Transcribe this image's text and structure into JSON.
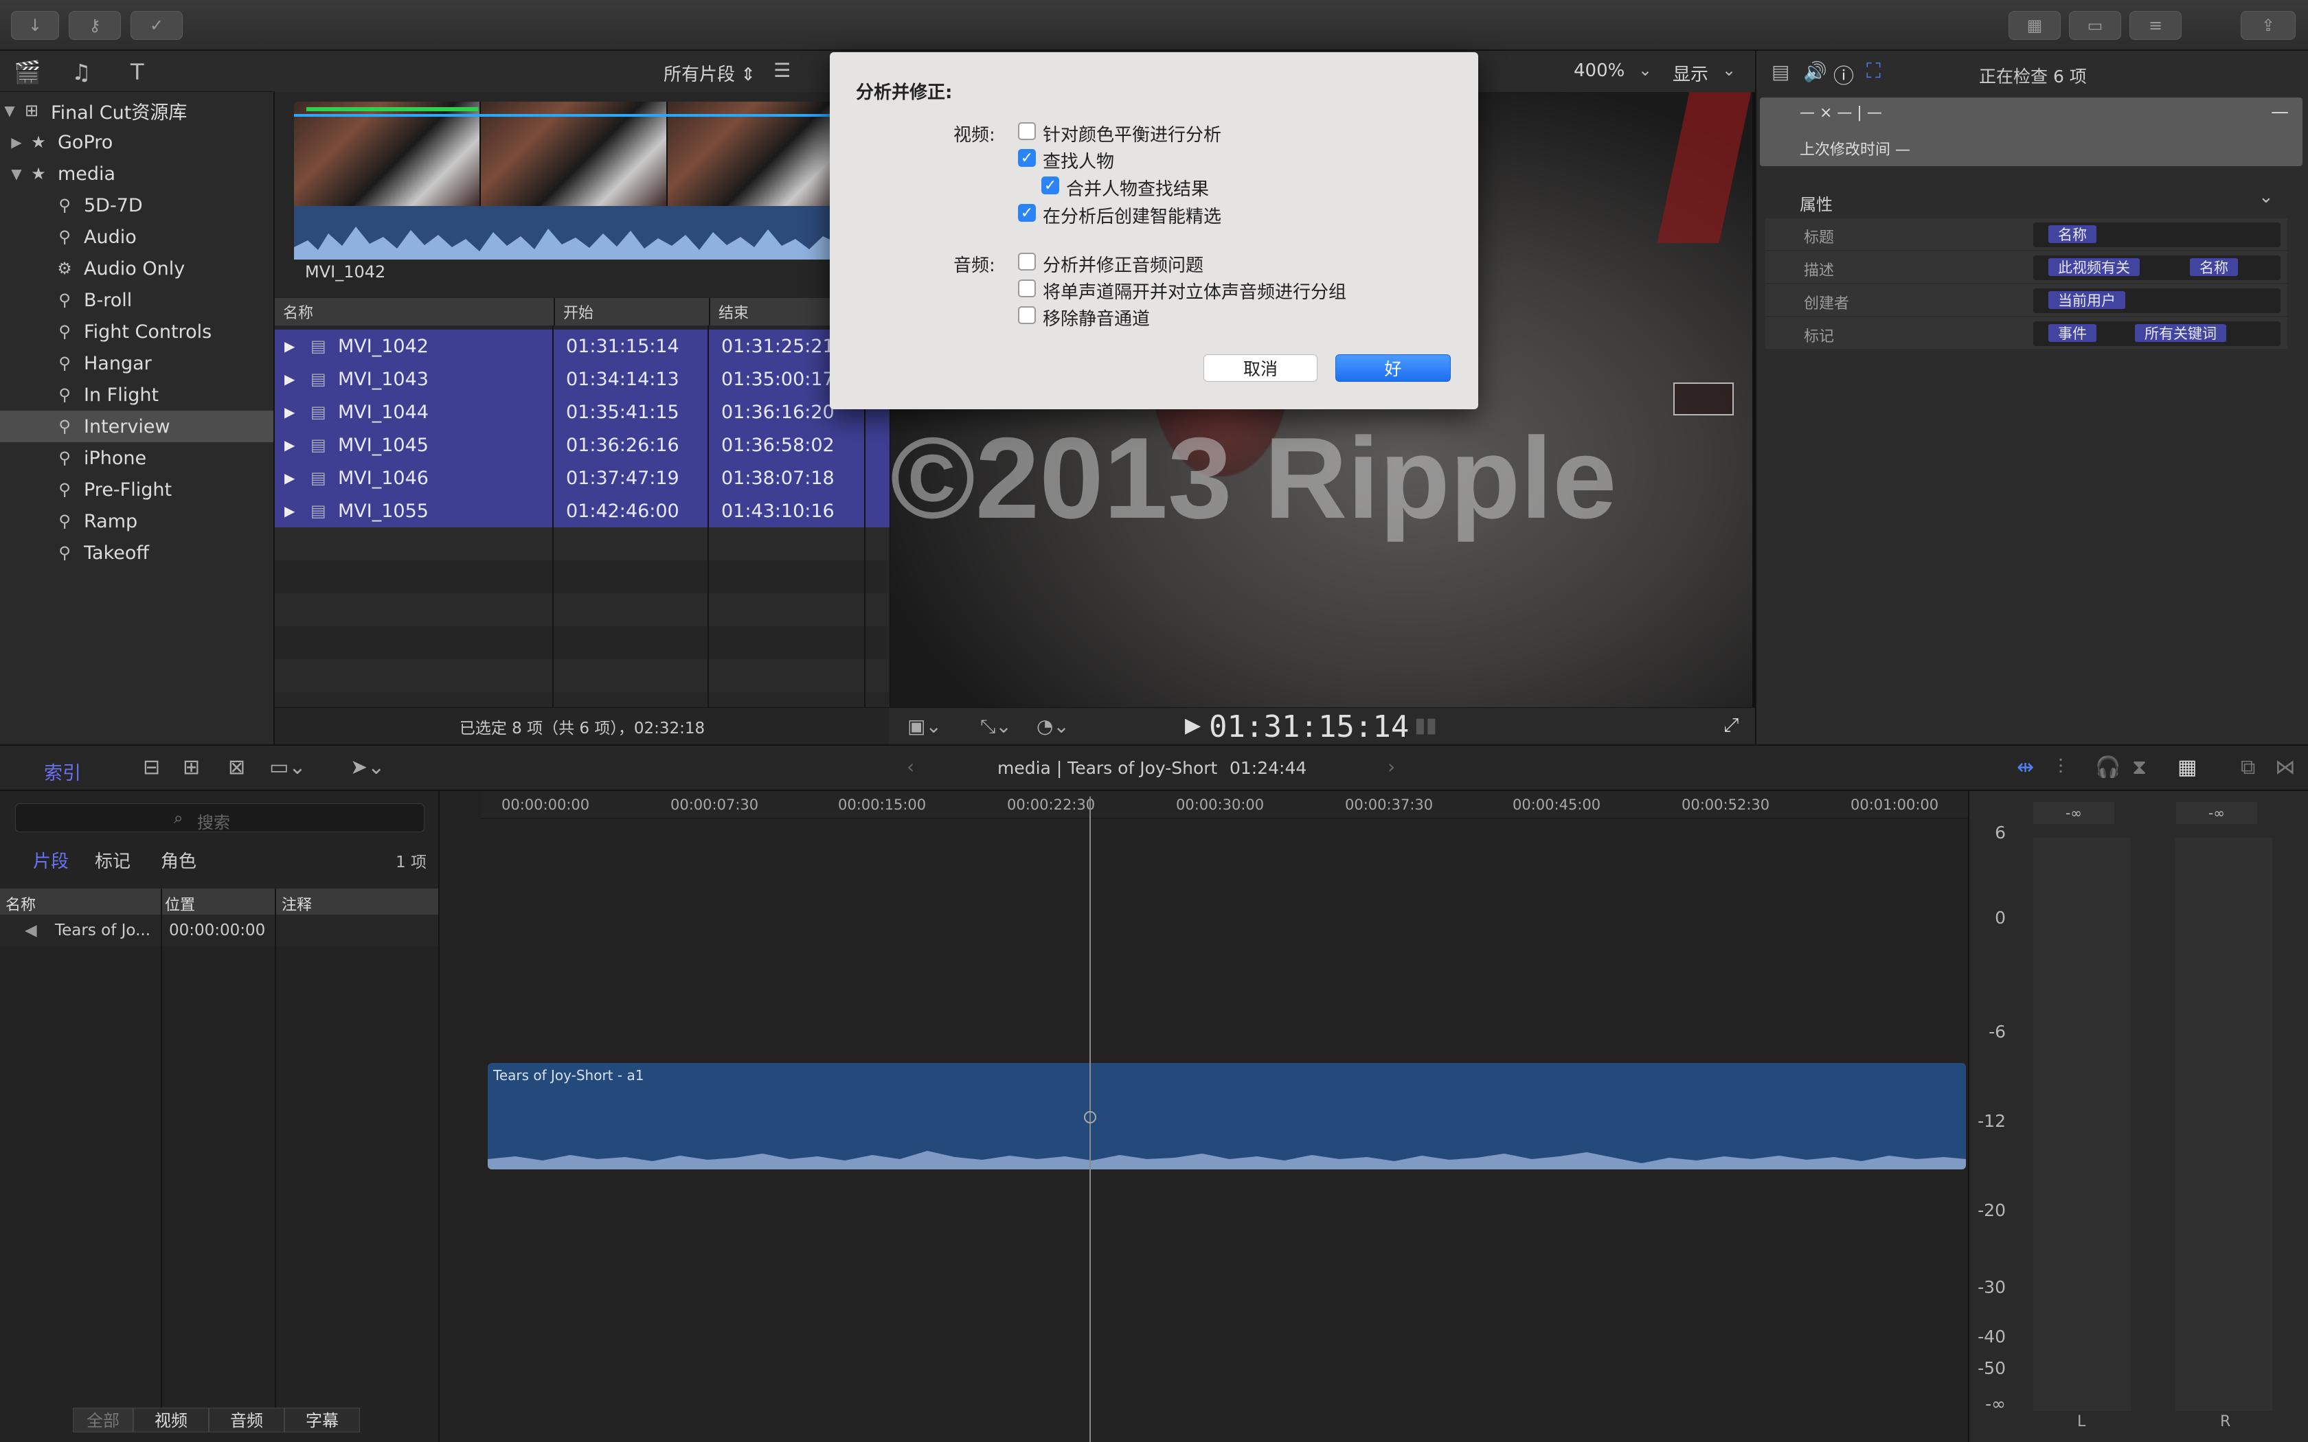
{
  "dialog": {
    "title": "分析并修正:",
    "video_label": "视频:",
    "audio_label": "音频:",
    "video_options": [
      {
        "label": "针对颜色平衡进行分析",
        "checked": false
      },
      {
        "label": "查找人物",
        "checked": true
      },
      {
        "label": "合并人物查找结果",
        "checked": true
      },
      {
        "label": "在分析后创建智能精选",
        "checked": true
      }
    ],
    "audio_options": [
      {
        "label": "分析并修正音频问题",
        "checked": false
      },
      {
        "label": "将单声道隔开并对立体声音频进行分组",
        "checked": false
      },
      {
        "label": "移除静音通道",
        "checked": false
      }
    ],
    "cancel_label": "取消",
    "ok_label": "好"
  },
  "library": {
    "root": "Final Cut资源库",
    "items": [
      {
        "label": "GoPro"
      },
      {
        "label": "media"
      },
      {
        "label": "5D-7D"
      },
      {
        "label": "Audio"
      },
      {
        "label": "Audio Only"
      },
      {
        "label": "B-roll"
      },
      {
        "label": "Fight Controls"
      },
      {
        "label": "Hangar"
      },
      {
        "label": "In Flight"
      },
      {
        "label": "Interview"
      },
      {
        "label": "iPhone"
      },
      {
        "label": "Pre-Flight"
      },
      {
        "label": "Ramp"
      },
      {
        "label": "Takeoff"
      }
    ]
  },
  "browser": {
    "filter_label": "所有片段 ⇕",
    "filmstrip_label": "MVI_1042",
    "columns": [
      "名称",
      "开始",
      "结束"
    ],
    "rows": [
      {
        "name": "MVI_1042",
        "start": "01:31:15:14",
        "end": "01:31:25:21"
      },
      {
        "name": "MVI_1043",
        "start": "01:34:14:13",
        "end": "01:35:00:17"
      },
      {
        "name": "MVI_1044",
        "start": "01:35:41:15",
        "end": "01:36:16:20"
      },
      {
        "name": "MVI_1045",
        "start": "01:36:26:16",
        "end": "01:36:58:02"
      },
      {
        "name": "MVI_1046",
        "start": "01:37:47:19",
        "end": "01:38:07:18"
      },
      {
        "name": "MVI_1055",
        "start": "01:42:46:00",
        "end": "01:43:10:16"
      }
    ],
    "status": "已选定 8 项（共 6 项），02:32:18"
  },
  "viewer": {
    "zoom": "400%",
    "display_label": "显示",
    "watermark": "©2013  Ripple",
    "timecode": "01:31:15:14"
  },
  "inspector": {
    "title": "正在检查 6 项",
    "placeholder": "— × — | —",
    "modified_label": "上次修改时间 —",
    "section": "属性",
    "rows": [
      {
        "label": "标题",
        "tokens": [
          "名称"
        ]
      },
      {
        "label": "描述",
        "tokens": [
          "此视频有关",
          "名称"
        ]
      },
      {
        "label": "创建者",
        "tokens": [
          "当前用户"
        ]
      },
      {
        "label": "标记",
        "tokens": [
          "事件",
          "所有关键词"
        ]
      }
    ]
  },
  "timeline": {
    "index_tab": "索引",
    "title": "media | Tears of Joy-Short",
    "duration": "01:24:44",
    "ruler": [
      "00:00:00:00",
      "00:00:07:30",
      "00:00:15:00",
      "00:00:22:30",
      "00:00:30:00",
      "00:00:37:30",
      "00:00:45:00",
      "00:00:52:30",
      "00:01:00:00"
    ],
    "clip_label": "Tears of Joy-Short - a1"
  },
  "index": {
    "search_placeholder": "搜索",
    "tabs": [
      "片段",
      "标记",
      "角色"
    ],
    "count": "1 项",
    "columns": [
      "名称",
      "位置",
      "注释"
    ],
    "rows": [
      {
        "name": "Tears of Jo...",
        "position": "00:00:00:00"
      }
    ],
    "filters": [
      "全部",
      "视频",
      "音频",
      "字幕"
    ]
  },
  "meters": {
    "scale": [
      "6",
      "0",
      "-6",
      "-12",
      "-20",
      "-30",
      "-40",
      "-50",
      "-∞"
    ],
    "peak_left": "-∞",
    "peak_right": "-∞",
    "channels": [
      "L",
      "R"
    ]
  },
  "colors": {
    "selection": "#3e3f92",
    "accent": "#2a84f7",
    "clip": "#234a7a"
  }
}
